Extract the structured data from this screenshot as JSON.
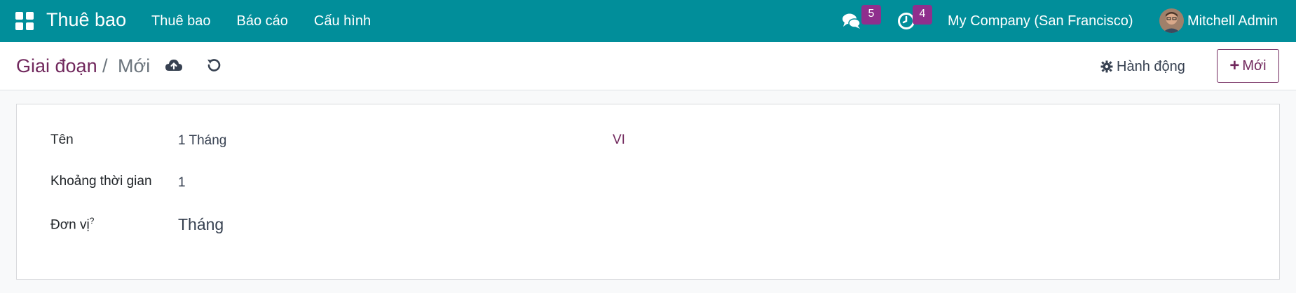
{
  "navbar": {
    "app_title": "Thuê bao",
    "menu": [
      "Thuê bao",
      "Báo cáo",
      "Cấu hình"
    ],
    "messages_count": "5",
    "activities_count": "4",
    "company": "My Company (San Francisco)",
    "user": "Mitchell Admin",
    "bg_color": "#018e9a",
    "badge_color": "#8f2f8d"
  },
  "control": {
    "breadcrumb_parent": "Giai đoạn",
    "breadcrumb_separator": "/",
    "breadcrumb_current": "Mới",
    "action_label": "Hành động",
    "new_label": "Mới",
    "accent": "#71285d"
  },
  "form": {
    "name_label": "Tên",
    "name_value": "1 Tháng",
    "lang_button": "VI",
    "duration_label": "Khoảng thời gian",
    "duration_value": "1",
    "unit_label": "Đơn vị",
    "unit_help": "?",
    "unit_value": "Tháng"
  }
}
